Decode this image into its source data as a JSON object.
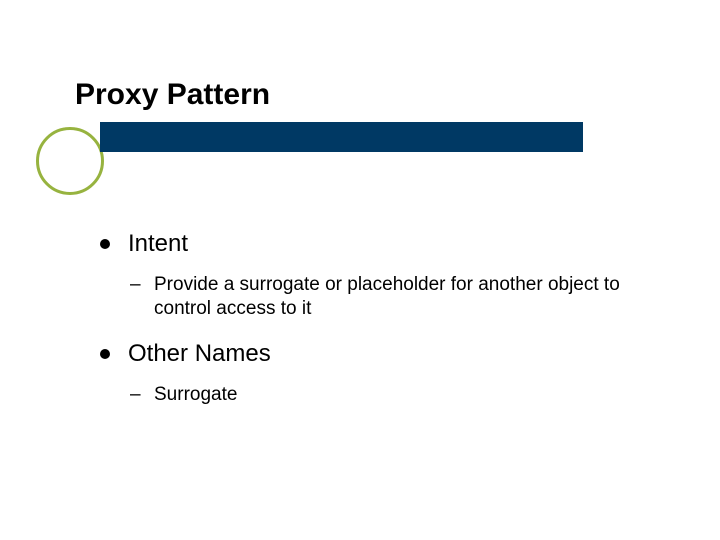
{
  "title": "Proxy Pattern",
  "accent_color": "#97b33f",
  "bar_color": "#003964",
  "items": [
    {
      "label": "Intent",
      "sub": [
        {
          "text": "Provide a surrogate or placeholder for another object to control access to it"
        }
      ]
    },
    {
      "label": "Other Names",
      "sub": [
        {
          "text": "Surrogate"
        }
      ]
    }
  ]
}
